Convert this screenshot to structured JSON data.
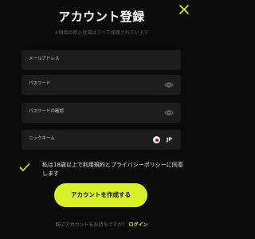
{
  "header": {
    "title": "アカウント登録",
    "subtitle": "※項目の新入登場はすべて保護されています",
    "close_icon": "close-icon"
  },
  "form": {
    "fields": [
      {
        "label": "メールアドレス"
      },
      {
        "label": "パスワード",
        "icon": "eye-icon"
      },
      {
        "label": "パスワードの確認",
        "icon": "eye-icon"
      },
      {
        "label": "ニックネーム",
        "country": "JP",
        "flag": "japan-flag-icon"
      }
    ],
    "agree_text": "私は18歳以上で利用規約とプライバシーポリシーに同意します",
    "submit_label": "アカウントを作成する"
  },
  "footer": {
    "prompt": "既にアカウントをお持ちですか？",
    "login_label": "ログイン"
  },
  "colors": {
    "accent": "#d7f22b",
    "background": "#0b0b0b",
    "field": "#1c1c1c"
  }
}
